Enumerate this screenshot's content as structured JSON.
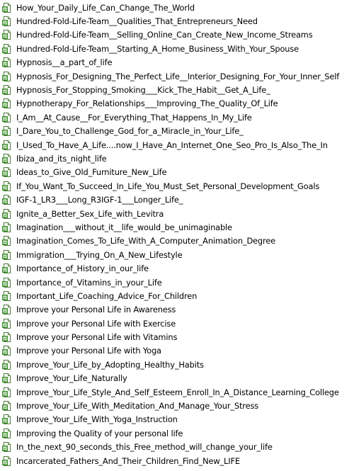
{
  "files": [
    {
      "name": "How_Your_Daily_Life_Can_Change_The_World",
      "icon": "text-document-icon"
    },
    {
      "name": "Hundred-Fold-Life-Team__Qualities_That_Entrepreneurs_Need",
      "icon": "text-document-icon"
    },
    {
      "name": "Hundred-Fold-Life-Team__Selling_Online_Can_Create_New_Income_Streams",
      "icon": "text-document-icon"
    },
    {
      "name": "Hundred-Fold-Life-Team__Starting_A_Home_Business_With_Your_Spouse",
      "icon": "text-document-icon"
    },
    {
      "name": "Hypnosis__a_part_of_life",
      "icon": "text-document-icon"
    },
    {
      "name": "Hypnosis_For_Designing_The_Perfect_Life__Interior_Designing_For_Your_Inner_Self",
      "icon": "text-document-icon"
    },
    {
      "name": "Hypnosis_For_Stopping_Smoking___Kick_The_Habit__Get_A_Life_",
      "icon": "text-document-icon"
    },
    {
      "name": "Hypnotherapy_For_Relationships___Improving_The_Quality_Of_Life",
      "icon": "text-document-icon"
    },
    {
      "name": "I_Am__At_Cause__For_Everything_That_Happens_In_My_Life",
      "icon": "text-document-icon"
    },
    {
      "name": "I_Dare_You_to_Challenge_God_for_a_Miracle_in_Your_Life_",
      "icon": "text-document-icon"
    },
    {
      "name": "I_Used_To_Have_A_Life....now_I_Have_An_Internet_One_Seo_Pro_Is_Also_The_In",
      "icon": "text-document-icon"
    },
    {
      "name": "Ibiza_and_its_night_life",
      "icon": "text-document-icon"
    },
    {
      "name": "Ideas_to_Give_Old_Furniture_New_Life",
      "icon": "text-document-icon"
    },
    {
      "name": "If_You_Want_To_Succeed_In_Life_You_Must_Set_Personal_Development_Goals",
      "icon": "text-document-icon"
    },
    {
      "name": "IGF-1_LR3___Long_R3IGF-1___Longer_Life_",
      "icon": "text-document-icon"
    },
    {
      "name": "Ignite_a_Better_Sex_Life_with_Levitra",
      "icon": "text-document-icon"
    },
    {
      "name": "Imagination___without_it__life_would_be_unimaginable",
      "icon": "text-document-icon"
    },
    {
      "name": "Imagination_Comes_To_Life_With_A_Computer_Animation_Degree",
      "icon": "text-document-icon"
    },
    {
      "name": "Immigration___Trying_On_A_New_Lifestyle",
      "icon": "text-document-icon"
    },
    {
      "name": "Importance_of_History_in_our_life",
      "icon": "text-document-icon"
    },
    {
      "name": "Importance_of_Vitamins_in_your_Life",
      "icon": "text-document-icon"
    },
    {
      "name": "Important_Life_Coaching_Advice_For_Children",
      "icon": "text-document-icon"
    },
    {
      "name": "Improve your Personal Life in Awareness",
      "icon": "text-document-icon"
    },
    {
      "name": "Improve your Personal Life with Exercise",
      "icon": "text-document-icon"
    },
    {
      "name": "Improve your Personal Life with Vitamins",
      "icon": "text-document-icon"
    },
    {
      "name": "Improve your Personal Life with Yoga",
      "icon": "text-document-icon"
    },
    {
      "name": "Improve_Your_Life_by_Adopting_Healthy_Habits",
      "icon": "text-document-icon"
    },
    {
      "name": "Improve_Your_Life_Naturally",
      "icon": "text-document-icon"
    },
    {
      "name": "Improve_Your_Life_Style_And_Self_Esteem_Enroll_In_A_Distance_Learning_College",
      "icon": "text-document-icon"
    },
    {
      "name": "Improve_Your_Life_With_Meditation_And_Manage_Your_Stress",
      "icon": "text-document-icon"
    },
    {
      "name": "Improve_Your_Life_With_Yoga_Instruction",
      "icon": "text-document-icon"
    },
    {
      "name": "Improving the Quality of your personal life",
      "icon": "text-document-icon"
    },
    {
      "name": "In_the_next_90_seconds_this_Free_method_will_change_your_life",
      "icon": "text-document-icon"
    },
    {
      "name": "Incarcerated_Fathers_And_Their_Children_Find_New_LIFE",
      "icon": "text-document-icon"
    }
  ]
}
